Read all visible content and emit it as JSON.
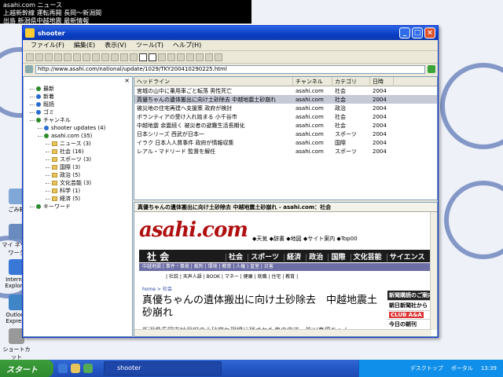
{
  "desktop": {
    "ticker_lines": [
      "asahi.com ニュース",
      "上越新幹線 運転再開 長岡〜新潟間",
      "出島 新潟県中越地震 最新情報"
    ],
    "icons": [
      {
        "label": "ごみ箱",
        "color": "#7fa8d8"
      },
      {
        "label": "マイ ネット ワーク",
        "color": "#6a8bc0"
      },
      {
        "label": "Internet Explorer",
        "color": "#3a78d8"
      },
      {
        "label": "Outlook Express",
        "color": "#3f86c9"
      },
      {
        "label": "ショートカット",
        "color": "#999999"
      }
    ]
  },
  "window": {
    "title": "shooter",
    "menu": [
      "ファイル(F)",
      "編集(E)",
      "表示(V)",
      "ツール(T)",
      "ヘルプ(H)"
    ],
    "address": "http://www.asahi.com/national/update/1029/TKY200410290225.html"
  },
  "tree": {
    "close_label": "×",
    "items": [
      {
        "label": "最新",
        "color": "#2a8a2a",
        "level": 0,
        "kind": "bullet"
      },
      {
        "label": "新着",
        "color": "#2a6ad0",
        "level": 0,
        "kind": "bullet"
      },
      {
        "label": "既読",
        "color": "#2a6ad0",
        "level": 0,
        "kind": "bullet"
      },
      {
        "label": "ゴミ",
        "color": "#2a6ad0",
        "level": 0,
        "kind": "bullet"
      },
      {
        "label": "チャンネル",
        "color": "#2a8a2a",
        "level": 0,
        "kind": "bullet"
      },
      {
        "label": "shooter updates (4)",
        "color": "#2a6ad0",
        "level": 1,
        "kind": "bullet"
      },
      {
        "label": "asahi.com (35)",
        "color": "#2a8a2a",
        "level": 1,
        "kind": "bullet"
      },
      {
        "label": "ニュース (3)",
        "level": 2,
        "kind": "folder"
      },
      {
        "label": "社会 (16)",
        "level": 2,
        "kind": "folder"
      },
      {
        "label": "スポーツ (3)",
        "level": 2,
        "kind": "folder"
      },
      {
        "label": "国際 (3)",
        "level": 2,
        "kind": "folder"
      },
      {
        "label": "政治 (5)",
        "level": 2,
        "kind": "folder"
      },
      {
        "label": "文化芸能 (3)",
        "level": 2,
        "kind": "folder"
      },
      {
        "label": "科学 (1)",
        "level": 2,
        "kind": "folder"
      },
      {
        "label": "経済 (5)",
        "level": 2,
        "kind": "folder"
      },
      {
        "label": "キーワード",
        "color": "#2a8a2a",
        "level": 0,
        "kind": "bullet"
      }
    ]
  },
  "headlines": {
    "columns": [
      "ヘッドライン",
      "チャンネル",
      "カテゴリ",
      "日時"
    ],
    "rows": [
      {
        "title": "宮城の山中に乗用車ごと転落 男性死亡",
        "source": "asahi.com",
        "category": "社会",
        "date": "2004",
        "selected": false
      },
      {
        "title": "真優ちゃんの遺体搬出に向け土砂除去 中越地震土砂崩れ",
        "source": "asahi.com",
        "category": "社会",
        "date": "2004",
        "selected": true
      },
      {
        "title": "被災地の住宅再建へ支援策 政府が検討",
        "source": "asahi.com",
        "category": "政治",
        "date": "2004",
        "selected": false
      },
      {
        "title": "ボランティアの受け入れ始まる 小千谷市",
        "source": "asahi.com",
        "category": "社会",
        "date": "2004",
        "selected": false
      },
      {
        "title": "中越地震 余震続く 被災者の避難生活長期化",
        "source": "asahi.com",
        "category": "社会",
        "date": "2004",
        "selected": false
      },
      {
        "title": "日本シリーズ 西武が日本一",
        "source": "asahi.com",
        "category": "スポーツ",
        "date": "2004",
        "selected": false
      },
      {
        "title": "イラク 日本人人質事件 政府が情報収集",
        "source": "asahi.com",
        "category": "国際",
        "date": "2004",
        "selected": false
      },
      {
        "title": "レアル・マドリード 監督を解任",
        "source": "asahi.com",
        "category": "スポーツ",
        "date": "2004",
        "selected": false
      }
    ]
  },
  "browser": {
    "title": "真優ちゃんの遺体搬出に向け土砂除去 中越地震土砂崩れ - asahi.com：社会",
    "logo": "asahi.com",
    "topnav": "◆天気 ◆辞書 ◆地図 ◆サイト案内 ◆Top00",
    "section": "社 会",
    "navs": [
      "社会",
      "スポーツ",
      "経済",
      "政治",
      "国際",
      "文化芸能",
      "サイエンス"
    ],
    "subnav": "中越地震 | 事件・事故 | 裁判 | 環境 | 教育 | 人権 | 皇室 | 災害",
    "sublinks": "| 社説 | 天声人語 | BOOK | マネー | 健康 | 就職 | 住宅 | 教育 |",
    "crumb": "home > 社会",
    "headline": "真優ちゃんの遺体搬出に向け土砂除去　中越地震土砂崩れ",
    "body": "新潟県長岡市妙見町の土砂崩れ現場に残された車の中で、皆川真優ちゃん",
    "ad_title": "新聞購読のご案内",
    "ad_line1": "朝日新聞社から",
    "ad_club": "CLUB A&A",
    "ad_line2": "今日の朝刊"
  },
  "taskbar": {
    "start": "スタート",
    "task": "shooter",
    "tray_items": [
      "デスクトップ",
      "ポータル",
      "13:39"
    ]
  }
}
